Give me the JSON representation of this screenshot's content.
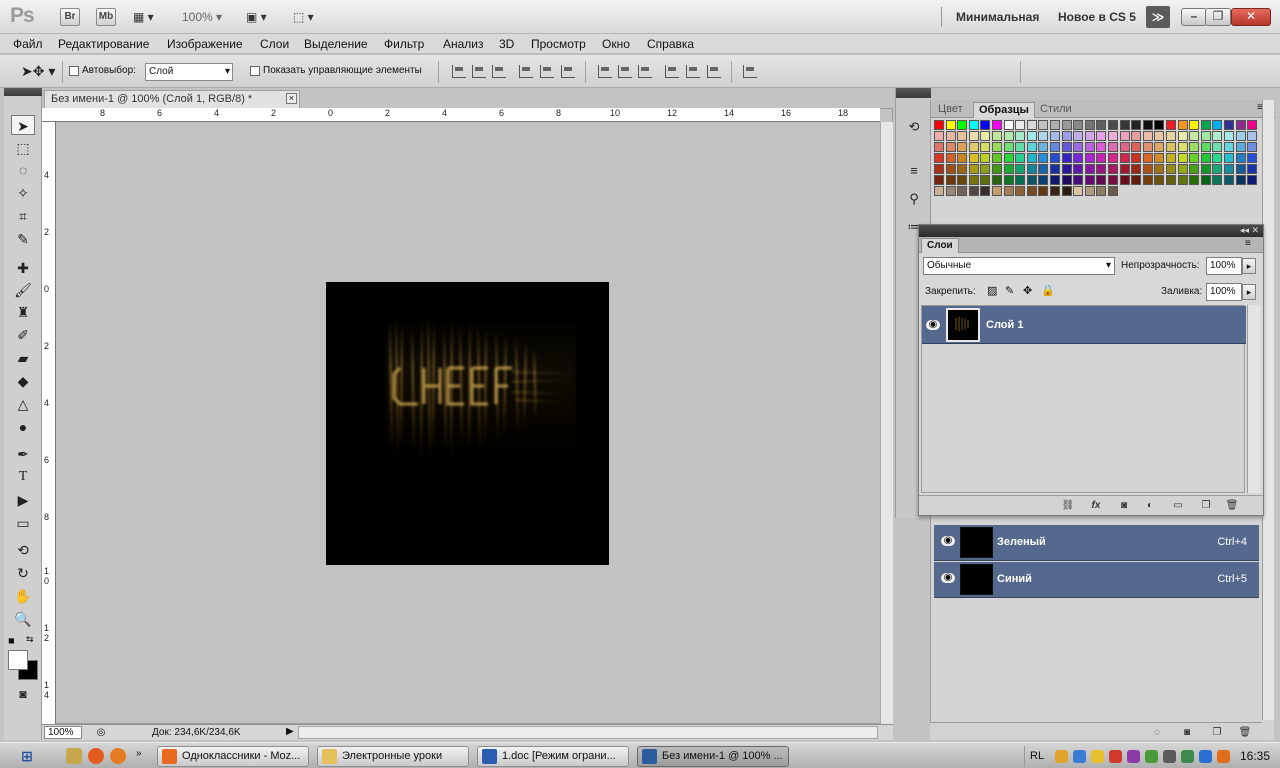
{
  "appbar": {
    "logo": "Ps",
    "br_label": "Br",
    "mb_label": "Mb",
    "zoom": "100%",
    "workspace_minimal": "Минимальная",
    "workspace_new": "Новое в CS 5",
    "more": "≫"
  },
  "menu": [
    "Файл",
    "Редактирование",
    "Изображение",
    "Слои",
    "Выделение",
    "Фильтр",
    "Анализ",
    "3D",
    "Просмотр",
    "Окно",
    "Справка"
  ],
  "options": {
    "autoselect_label": "Автовыбор:",
    "autoselect_value": "Слой",
    "show_controls_label": "Показать управляющие элементы"
  },
  "document": {
    "tab_title": "Без имени-1 @ 100% (Слой 1, RGB/8) *",
    "close": "×",
    "zoom_field": "100%",
    "doc_info": "Док: 234,6K/234,6K",
    "hruler_ticks": [
      "8",
      "6",
      "4",
      "2",
      "0",
      "2",
      "4",
      "6",
      "8",
      "10",
      "12",
      "14",
      "16",
      "18"
    ],
    "vruler_ticks": [
      "4",
      "2",
      "0",
      "2",
      "4",
      "6",
      "8",
      "1 0",
      "1 2",
      "1 4"
    ]
  },
  "swatches_panel": {
    "tabs": [
      "Цвет",
      "Образцы",
      "Стили"
    ],
    "active_tab": "Образцы"
  },
  "channels": [
    {
      "name": "Зеленый",
      "shortcut": "Ctrl+4"
    },
    {
      "name": "Синий",
      "shortcut": "Ctrl+5"
    }
  ],
  "layers_panel": {
    "tab": "Слои",
    "blend_mode": "Обычные",
    "opacity_label": "Непрозрачность:",
    "opacity": "100%",
    "lock_label": "Закрепить:",
    "fill_label": "Заливка:",
    "fill": "100%",
    "layer_name": "Слой 1"
  },
  "taskbar": {
    "items": [
      {
        "label": "Одноклассники - Moz...",
        "color": "#e66a1f"
      },
      {
        "label": "Электронные уроки",
        "color": "#e4c15a"
      },
      {
        "label": "1.doc [Режим ограни...",
        "color": "#2a5db0"
      },
      {
        "label": "Без имени-1 @ 100% ...",
        "color": "#2b5d9e"
      }
    ],
    "lang": "RL",
    "clock": "16:35"
  },
  "colors": {
    "selected_row": "#55698f",
    "gold_glow": "#c99a3a"
  }
}
